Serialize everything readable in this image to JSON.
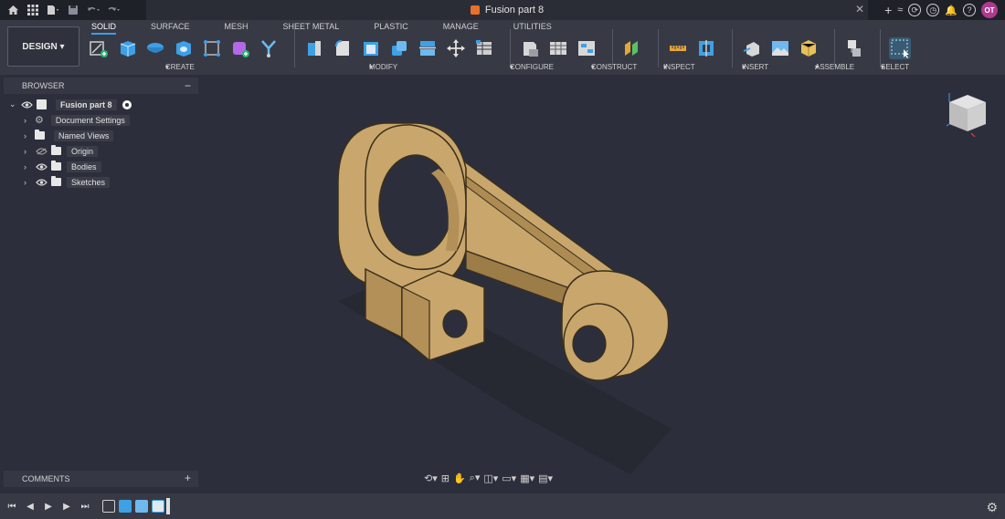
{
  "title_bar": {
    "document_title": "Fusion part 8",
    "avatar_initials": "OT",
    "icons": [
      "home-icon",
      "grid-icon",
      "file-icon",
      "save-icon",
      "undo-icon",
      "redo-icon",
      "plus-icon",
      "status-icon",
      "extensions-icon",
      "clock-icon",
      "bell-icon",
      "help-icon"
    ]
  },
  "workspace": {
    "design_button": "DESIGN"
  },
  "tabs": [
    "SOLID",
    "SURFACE",
    "MESH",
    "SHEET METAL",
    "PLASTIC",
    "MANAGE",
    "UTILITIES"
  ],
  "active_tab": "SOLID",
  "groups": {
    "create": "CREATE",
    "modify": "MODIFY",
    "configure": "CONFIGURE",
    "construct": "CONSTRUCT",
    "inspect": "INSPECT",
    "insert": "INSERT",
    "assemble": "ASSEMBLE",
    "select": "SELECT"
  },
  "browser": {
    "header": "BROWSER",
    "root": "Fusion part 8",
    "items": [
      {
        "label": "Document Settings"
      },
      {
        "label": "Named Views"
      },
      {
        "label": "Origin"
      },
      {
        "label": "Bodies"
      },
      {
        "label": "Sketches"
      }
    ]
  },
  "comments": {
    "label": "COMMENTS"
  },
  "colors": {
    "accent": "#3a9df0",
    "part": "#c9a66b",
    "background": "#2c2f3b"
  }
}
